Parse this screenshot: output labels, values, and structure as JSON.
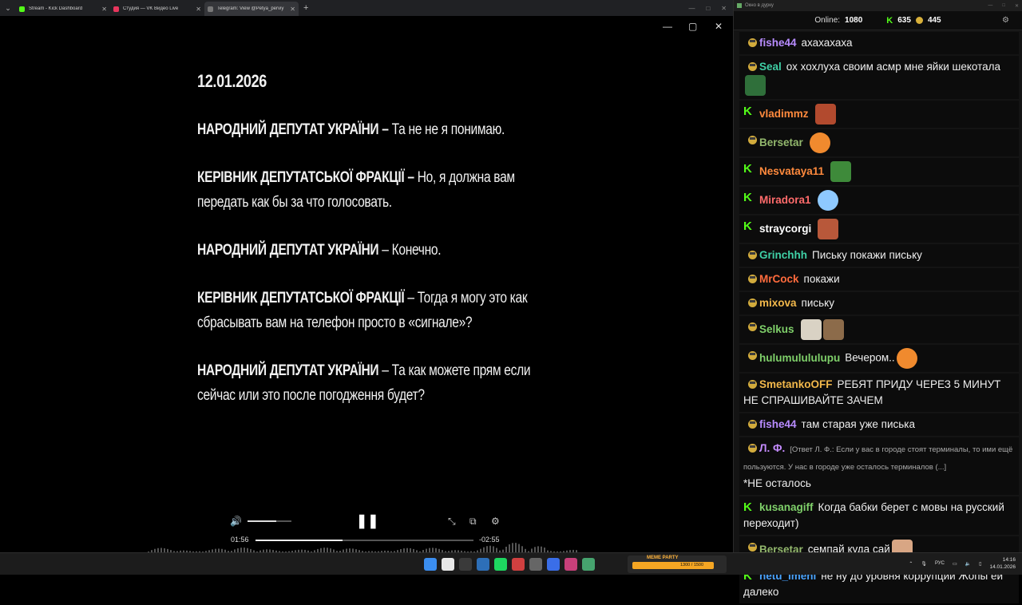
{
  "browser": {
    "tabs": [
      {
        "title": "Stream - Kick Dashboard",
        "favicon_color": "#53fc18",
        "active": false
      },
      {
        "title": "Студия — VK Видео Live",
        "favicon_color": "#e8365d",
        "active": false
      },
      {
        "title": "Telegram: View @Petya_perviy",
        "favicon_color": "#777777",
        "active": true
      }
    ]
  },
  "video": {
    "date": "12.01.2026",
    "paragraphs": [
      {
        "speaker": "НАРОДНИЙ ДЕПУТАТ УКРАЇНИ –",
        "text": "Та не не я понимаю."
      },
      {
        "speaker": "КЕРІВНИК ДЕПУТАТСЬКОЇ ФРАКЦІЇ –",
        "text": "Но, я должна вам передать как бы за что голосовать."
      },
      {
        "speaker": "НАРОДНИЙ ДЕПУТАТ УКРАЇНИ",
        "text": "– Конечно."
      },
      {
        "speaker": "КЕРІВНИК ДЕПУТАТСЬКОЇ ФРАКЦІЇ",
        "text": "– Тогда я могу это как сбрасывать вам на телефон просто в «сигнале»?"
      },
      {
        "speaker": "НАРОДНИЙ ДЕПУТАТ УКРАЇНИ",
        "text": "– Та как можете прям если сейчас или это после погодження будет?"
      }
    ],
    "player": {
      "elapsed": "01:56",
      "remaining": "-02:55",
      "progress": 0.4,
      "volume": 0.65
    }
  },
  "chat": {
    "window_title": "Окно в дурку",
    "online_label": "Online:",
    "online_count": "1080",
    "kick_count": "635",
    "other_count": "445",
    "messages": [
      {
        "badge": "e",
        "user": "fishe44",
        "color": "#b88cff",
        "text": "ахахахаха",
        "emotes": []
      },
      {
        "badge": "e",
        "user": "Seal",
        "color": "#3fd0a6",
        "text": "ох хохлуха своим асмр мне яйки шекотала",
        "emotes": [
          "#2f6f3a"
        ]
      },
      {
        "badge": "k",
        "user": "vladimmz",
        "color": "#ff8a3d",
        "text": "",
        "emotes": [
          "#b24a2e"
        ]
      },
      {
        "badge": "e",
        "user": "Bersetar",
        "color": "#93b86d",
        "text": "",
        "emotes": [
          "round:#f08a2e"
        ]
      },
      {
        "badge": "k",
        "user": "Nesvataya11",
        "color": "#ff8a3d",
        "text": "",
        "emotes": [
          "#3e8a3a"
        ]
      },
      {
        "badge": "k",
        "user": "Miradora1",
        "color": "#ff6b6b",
        "text": "",
        "emotes": [
          "round:#8ec9ff"
        ]
      },
      {
        "badge": "k",
        "user": "straycorgi",
        "color": "#ffffff",
        "text": "",
        "emotes": [
          "#b8583a"
        ]
      },
      {
        "badge": "e",
        "user": "Grinchhh",
        "color": "#3fd0a6",
        "text": "Письку покажи письку",
        "emotes": []
      },
      {
        "badge": "e",
        "user": "MrCock",
        "color": "#ff6b3d",
        "text": "покажи",
        "emotes": []
      },
      {
        "badge": "e",
        "user": "mixova",
        "color": "#f2b84b",
        "text": "письку",
        "emotes": []
      },
      {
        "badge": "e",
        "user": "Selkus",
        "color": "#7fd06a",
        "text": "",
        "emotes": [
          "#d9d2c4",
          "#8c6b4a"
        ]
      },
      {
        "badge": "e",
        "user": "hulumulululupu",
        "color": "#7fd06a",
        "text": "Вечером..",
        "emotes": [
          "round:#f08a2e"
        ]
      },
      {
        "badge": "e",
        "user": "SmetankoOFF",
        "color": "#f2b84b",
        "text": "РЕБЯТ ПРИДУ ЧЕРЕЗ 5 МИНУТ НЕ СПРАШИВАЙТЕ ЗАЧЕМ",
        "emotes": []
      },
      {
        "badge": "e",
        "user": "fishe44",
        "color": "#b88cff",
        "text": "там старая уже писька",
        "emotes": []
      },
      {
        "badge": "e",
        "user": "Л. Ф.",
        "color": "#c58cff",
        "reply": "[Ответ Л. Ф.: Если у вас в городе стоят терминалы, то ими ещё пользуются. У нас в городе уже осталось терминалов (...]",
        "text": "*НЕ осталось",
        "emotes": []
      },
      {
        "badge": "k",
        "user": "kusanagiff",
        "color": "#7fd06a",
        "text": "Когда бабки берет с мовы на русский переходит)",
        "emotes": []
      },
      {
        "badge": "e",
        "user": "Bersetar",
        "color": "#93b86d",
        "text": "семпай куда сай",
        "emotes": [
          "#d8a684"
        ]
      },
      {
        "badge": "k",
        "user": "netu_imeni",
        "color": "#4aa3ff",
        "text": "не ну до уровня коррупции Жопы ей далеко",
        "emotes": []
      }
    ]
  },
  "taskbar": {
    "meme_label": "MEME PARTY",
    "meme_value": "1300 / 1500",
    "lang": "РУС",
    "time": "14:16",
    "date": "14.01.2026",
    "icon_colors": [
      "#3b8ef0",
      "#e8e8e8",
      "#3a3a3a",
      "#2d6fb8",
      "#1ed760",
      "#d04040",
      "#666666",
      "#3a6ee8",
      "#c8407a",
      "#46a36e"
    ]
  }
}
